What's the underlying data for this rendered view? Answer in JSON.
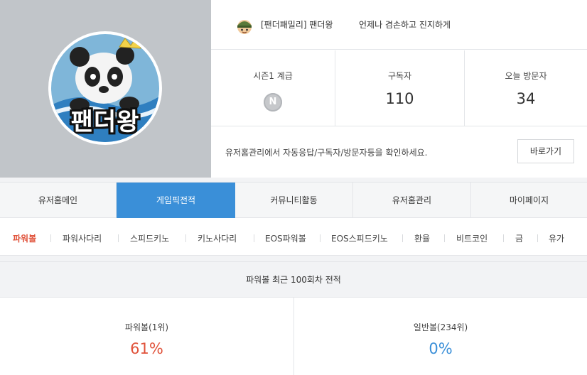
{
  "profile": {
    "avatar_text": "팬더왕",
    "rank_icon": "soldier-icon",
    "nickname": "[팬더패밀리] 팬더왕",
    "motto": "언제나 겸손하고 진지하게"
  },
  "stats": {
    "season_label": "시즌1 계급",
    "tier_badge": "N",
    "subscribers_label": "구독자",
    "subscribers_value": "110",
    "visitors_label": "오늘 방문자",
    "visitors_value": "34"
  },
  "notice": {
    "text": "유저홈관리에서 자동응답/구독자/방문자등을 확인하세요.",
    "button": "바로가기"
  },
  "main_tabs": [
    {
      "label": "유저홈메인",
      "active": false
    },
    {
      "label": "게임픽전적",
      "active": true
    },
    {
      "label": "커뮤니티활동",
      "active": false
    },
    {
      "label": "유저홈관리",
      "active": false
    },
    {
      "label": "마이페이지",
      "active": false
    }
  ],
  "sub_tabs": [
    {
      "label": "파워볼",
      "active": true
    },
    {
      "label": "파워사다리",
      "active": false
    },
    {
      "label": "스피드키노",
      "active": false
    },
    {
      "label": "키노사다리",
      "active": false
    },
    {
      "label": "EOS파워볼",
      "active": false
    },
    {
      "label": "EOS스피드키노",
      "active": false
    },
    {
      "label": "환율",
      "active": false
    },
    {
      "label": "비트코인",
      "active": false
    },
    {
      "label": "금",
      "active": false
    },
    {
      "label": "유가",
      "active": false
    }
  ],
  "record": {
    "title": "파워볼 최근 100회차 전적",
    "powerball_label": "파워볼(1위)",
    "powerball_value": "61%",
    "normal_label": "일반볼(234위)",
    "normal_value": "0%"
  },
  "colors": {
    "accent_blue": "#3a8fd8",
    "accent_red": "#e0523a",
    "avatar_panel": "#c1c5c9"
  }
}
